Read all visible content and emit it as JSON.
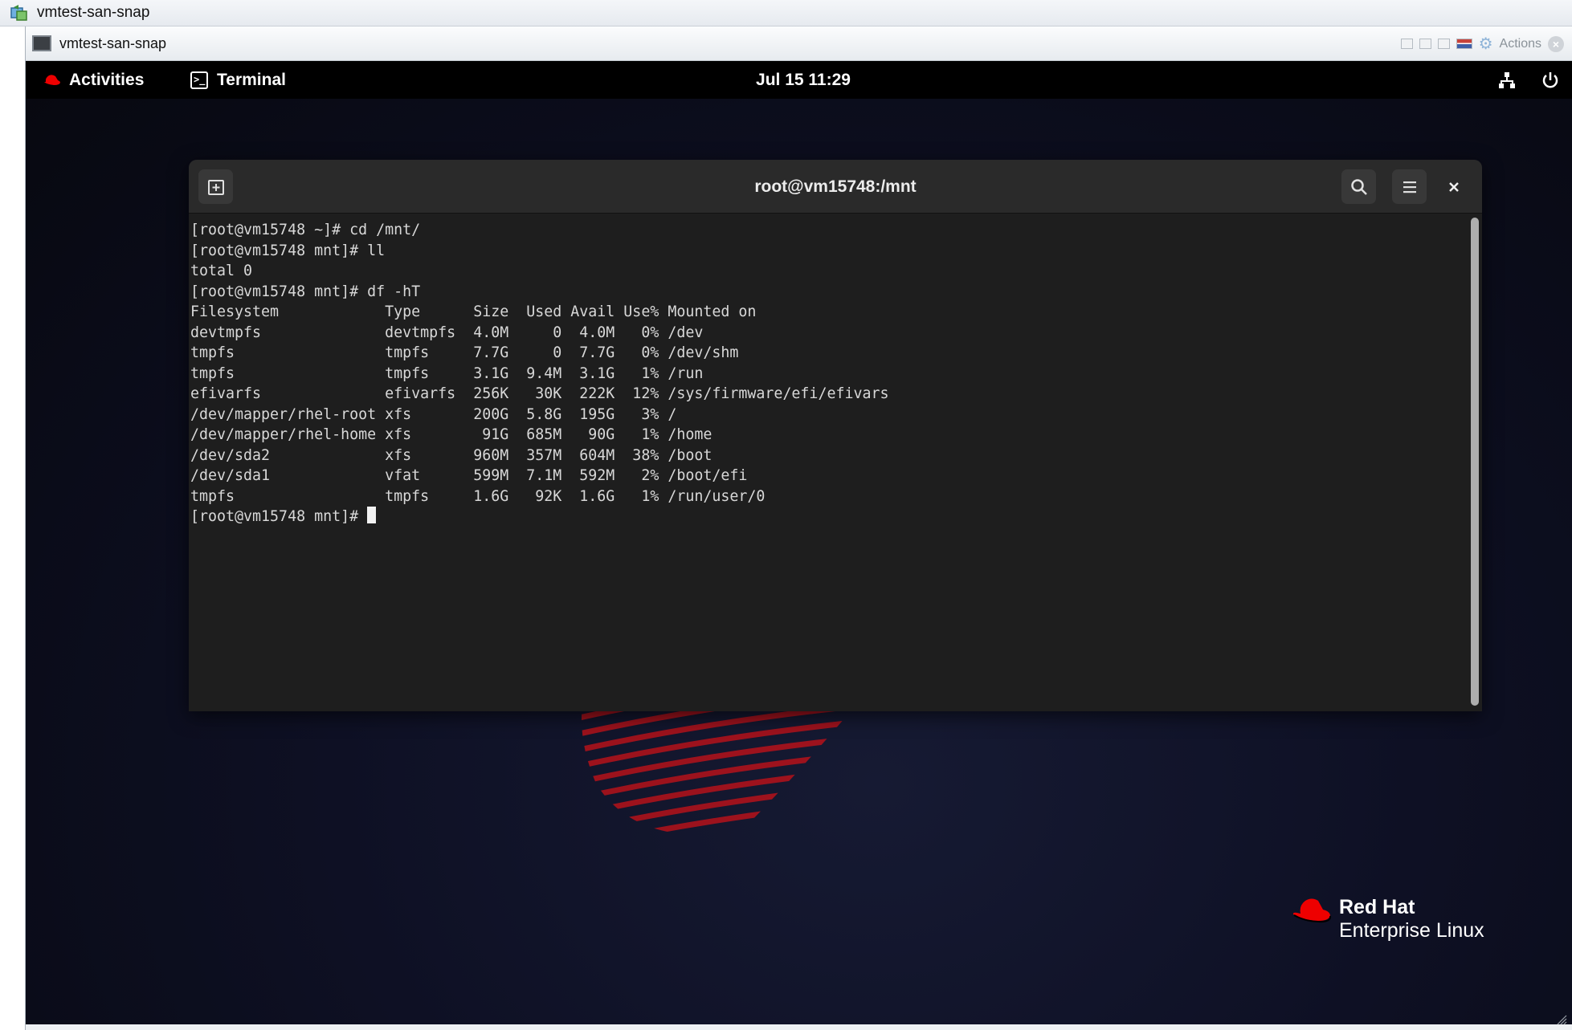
{
  "outer": {
    "title": "vmtest-san-snap"
  },
  "console": {
    "title": "vmtest-san-snap",
    "actions_label": "Actions"
  },
  "topbar": {
    "activities": "Activities",
    "app_name": "Terminal",
    "clock": "Jul 15  11:29"
  },
  "terminal": {
    "title": "root@vm15748:/mnt",
    "lines": [
      "[root@vm15748 ~]# cd /mnt/",
      "[root@vm15748 mnt]# ll",
      "total 0",
      "[root@vm15748 mnt]# df -hT",
      "Filesystem            Type      Size  Used Avail Use% Mounted on",
      "devtmpfs              devtmpfs  4.0M     0  4.0M   0% /dev",
      "tmpfs                 tmpfs     7.7G     0  7.7G   0% /dev/shm",
      "tmpfs                 tmpfs     3.1G  9.4M  3.1G   1% /run",
      "efivarfs              efivarfs  256K   30K  222K  12% /sys/firmware/efi/efivars",
      "/dev/mapper/rhel-root xfs       200G  5.8G  195G   3% /",
      "/dev/mapper/rhel-home xfs        91G  685M   90G   1% /home",
      "/dev/sda2             xfs       960M  357M  604M  38% /boot",
      "/dev/sda1             vfat      599M  7.1M  592M   2% /boot/efi",
      "tmpfs                 tmpfs     1.6G   92K  1.6G   1% /run/user/0"
    ],
    "prompt": "[root@vm15748 mnt]# "
  },
  "branding": {
    "line1": "Red Hat",
    "line2": "Enterprise Linux"
  },
  "colors": {
    "redhat_red": "#ee0000",
    "terminal_bg": "#1e1e1e",
    "terminal_fg": "#d8d8d8"
  }
}
